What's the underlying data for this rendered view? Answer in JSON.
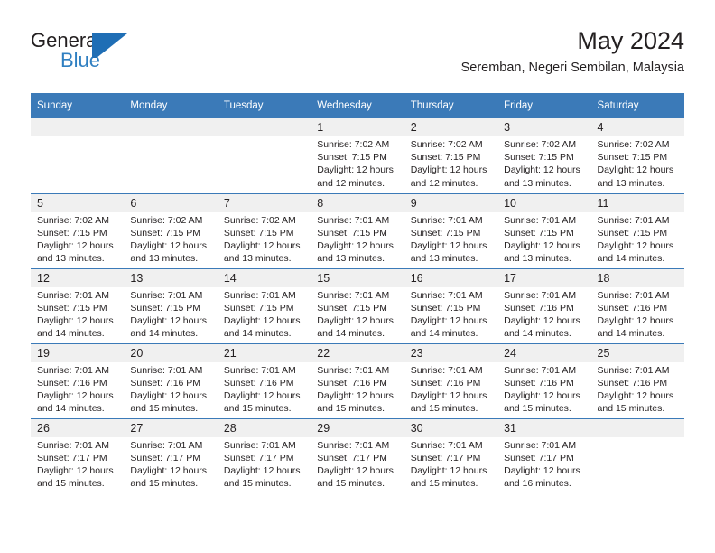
{
  "brand": {
    "word_one": "General",
    "word_two": "Blue",
    "mark_icon": "triangle-flag-icon",
    "accent_color": "#2f7fc1",
    "mark_color": "#1f6eb5"
  },
  "header": {
    "month_title": "May 2024",
    "location": "Seremban, Negeri Sembilan, Malaysia"
  },
  "calendar": {
    "header_bg": "#3b7ab8",
    "daycell_strip_bg": "#f0f0f0",
    "weekday_headers": [
      "Sunday",
      "Monday",
      "Tuesday",
      "Wednesday",
      "Thursday",
      "Friday",
      "Saturday"
    ],
    "weeks": [
      [
        {
          "day": "",
          "empty": true,
          "sunrise": "",
          "sunset": "",
          "daylight_1": "",
          "daylight_2": ""
        },
        {
          "day": "",
          "empty": true,
          "sunrise": "",
          "sunset": "",
          "daylight_1": "",
          "daylight_2": ""
        },
        {
          "day": "",
          "empty": true,
          "sunrise": "",
          "sunset": "",
          "daylight_1": "",
          "daylight_2": ""
        },
        {
          "day": "1",
          "empty": false,
          "sunrise": "Sunrise: 7:02 AM",
          "sunset": "Sunset: 7:15 PM",
          "daylight_1": "Daylight: 12 hours",
          "daylight_2": "and 12 minutes."
        },
        {
          "day": "2",
          "empty": false,
          "sunrise": "Sunrise: 7:02 AM",
          "sunset": "Sunset: 7:15 PM",
          "daylight_1": "Daylight: 12 hours",
          "daylight_2": "and 12 minutes."
        },
        {
          "day": "3",
          "empty": false,
          "sunrise": "Sunrise: 7:02 AM",
          "sunset": "Sunset: 7:15 PM",
          "daylight_1": "Daylight: 12 hours",
          "daylight_2": "and 13 minutes."
        },
        {
          "day": "4",
          "empty": false,
          "sunrise": "Sunrise: 7:02 AM",
          "sunset": "Sunset: 7:15 PM",
          "daylight_1": "Daylight: 12 hours",
          "daylight_2": "and 13 minutes."
        }
      ],
      [
        {
          "day": "5",
          "empty": false,
          "sunrise": "Sunrise: 7:02 AM",
          "sunset": "Sunset: 7:15 PM",
          "daylight_1": "Daylight: 12 hours",
          "daylight_2": "and 13 minutes."
        },
        {
          "day": "6",
          "empty": false,
          "sunrise": "Sunrise: 7:02 AM",
          "sunset": "Sunset: 7:15 PM",
          "daylight_1": "Daylight: 12 hours",
          "daylight_2": "and 13 minutes."
        },
        {
          "day": "7",
          "empty": false,
          "sunrise": "Sunrise: 7:02 AM",
          "sunset": "Sunset: 7:15 PM",
          "daylight_1": "Daylight: 12 hours",
          "daylight_2": "and 13 minutes."
        },
        {
          "day": "8",
          "empty": false,
          "sunrise": "Sunrise: 7:01 AM",
          "sunset": "Sunset: 7:15 PM",
          "daylight_1": "Daylight: 12 hours",
          "daylight_2": "and 13 minutes."
        },
        {
          "day": "9",
          "empty": false,
          "sunrise": "Sunrise: 7:01 AM",
          "sunset": "Sunset: 7:15 PM",
          "daylight_1": "Daylight: 12 hours",
          "daylight_2": "and 13 minutes."
        },
        {
          "day": "10",
          "empty": false,
          "sunrise": "Sunrise: 7:01 AM",
          "sunset": "Sunset: 7:15 PM",
          "daylight_1": "Daylight: 12 hours",
          "daylight_2": "and 13 minutes."
        },
        {
          "day": "11",
          "empty": false,
          "sunrise": "Sunrise: 7:01 AM",
          "sunset": "Sunset: 7:15 PM",
          "daylight_1": "Daylight: 12 hours",
          "daylight_2": "and 14 minutes."
        }
      ],
      [
        {
          "day": "12",
          "empty": false,
          "sunrise": "Sunrise: 7:01 AM",
          "sunset": "Sunset: 7:15 PM",
          "daylight_1": "Daylight: 12 hours",
          "daylight_2": "and 14 minutes."
        },
        {
          "day": "13",
          "empty": false,
          "sunrise": "Sunrise: 7:01 AM",
          "sunset": "Sunset: 7:15 PM",
          "daylight_1": "Daylight: 12 hours",
          "daylight_2": "and 14 minutes."
        },
        {
          "day": "14",
          "empty": false,
          "sunrise": "Sunrise: 7:01 AM",
          "sunset": "Sunset: 7:15 PM",
          "daylight_1": "Daylight: 12 hours",
          "daylight_2": "and 14 minutes."
        },
        {
          "day": "15",
          "empty": false,
          "sunrise": "Sunrise: 7:01 AM",
          "sunset": "Sunset: 7:15 PM",
          "daylight_1": "Daylight: 12 hours",
          "daylight_2": "and 14 minutes."
        },
        {
          "day": "16",
          "empty": false,
          "sunrise": "Sunrise: 7:01 AM",
          "sunset": "Sunset: 7:15 PM",
          "daylight_1": "Daylight: 12 hours",
          "daylight_2": "and 14 minutes."
        },
        {
          "day": "17",
          "empty": false,
          "sunrise": "Sunrise: 7:01 AM",
          "sunset": "Sunset: 7:16 PM",
          "daylight_1": "Daylight: 12 hours",
          "daylight_2": "and 14 minutes."
        },
        {
          "day": "18",
          "empty": false,
          "sunrise": "Sunrise: 7:01 AM",
          "sunset": "Sunset: 7:16 PM",
          "daylight_1": "Daylight: 12 hours",
          "daylight_2": "and 14 minutes."
        }
      ],
      [
        {
          "day": "19",
          "empty": false,
          "sunrise": "Sunrise: 7:01 AM",
          "sunset": "Sunset: 7:16 PM",
          "daylight_1": "Daylight: 12 hours",
          "daylight_2": "and 14 minutes."
        },
        {
          "day": "20",
          "empty": false,
          "sunrise": "Sunrise: 7:01 AM",
          "sunset": "Sunset: 7:16 PM",
          "daylight_1": "Daylight: 12 hours",
          "daylight_2": "and 15 minutes."
        },
        {
          "day": "21",
          "empty": false,
          "sunrise": "Sunrise: 7:01 AM",
          "sunset": "Sunset: 7:16 PM",
          "daylight_1": "Daylight: 12 hours",
          "daylight_2": "and 15 minutes."
        },
        {
          "day": "22",
          "empty": false,
          "sunrise": "Sunrise: 7:01 AM",
          "sunset": "Sunset: 7:16 PM",
          "daylight_1": "Daylight: 12 hours",
          "daylight_2": "and 15 minutes."
        },
        {
          "day": "23",
          "empty": false,
          "sunrise": "Sunrise: 7:01 AM",
          "sunset": "Sunset: 7:16 PM",
          "daylight_1": "Daylight: 12 hours",
          "daylight_2": "and 15 minutes."
        },
        {
          "day": "24",
          "empty": false,
          "sunrise": "Sunrise: 7:01 AM",
          "sunset": "Sunset: 7:16 PM",
          "daylight_1": "Daylight: 12 hours",
          "daylight_2": "and 15 minutes."
        },
        {
          "day": "25",
          "empty": false,
          "sunrise": "Sunrise: 7:01 AM",
          "sunset": "Sunset: 7:16 PM",
          "daylight_1": "Daylight: 12 hours",
          "daylight_2": "and 15 minutes."
        }
      ],
      [
        {
          "day": "26",
          "empty": false,
          "sunrise": "Sunrise: 7:01 AM",
          "sunset": "Sunset: 7:17 PM",
          "daylight_1": "Daylight: 12 hours",
          "daylight_2": "and 15 minutes."
        },
        {
          "day": "27",
          "empty": false,
          "sunrise": "Sunrise: 7:01 AM",
          "sunset": "Sunset: 7:17 PM",
          "daylight_1": "Daylight: 12 hours",
          "daylight_2": "and 15 minutes."
        },
        {
          "day": "28",
          "empty": false,
          "sunrise": "Sunrise: 7:01 AM",
          "sunset": "Sunset: 7:17 PM",
          "daylight_1": "Daylight: 12 hours",
          "daylight_2": "and 15 minutes."
        },
        {
          "day": "29",
          "empty": false,
          "sunrise": "Sunrise: 7:01 AM",
          "sunset": "Sunset: 7:17 PM",
          "daylight_1": "Daylight: 12 hours",
          "daylight_2": "and 15 minutes."
        },
        {
          "day": "30",
          "empty": false,
          "sunrise": "Sunrise: 7:01 AM",
          "sunset": "Sunset: 7:17 PM",
          "daylight_1": "Daylight: 12 hours",
          "daylight_2": "and 15 minutes."
        },
        {
          "day": "31",
          "empty": false,
          "sunrise": "Sunrise: 7:01 AM",
          "sunset": "Sunset: 7:17 PM",
          "daylight_1": "Daylight: 12 hours",
          "daylight_2": "and 16 minutes."
        },
        {
          "day": "",
          "empty": true,
          "sunrise": "",
          "sunset": "",
          "daylight_1": "",
          "daylight_2": ""
        }
      ]
    ]
  }
}
